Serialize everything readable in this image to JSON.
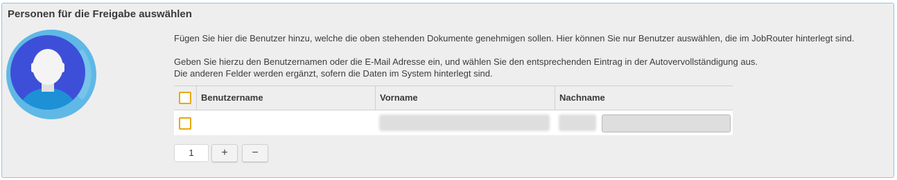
{
  "panel": {
    "title": "Personen für die Freigabe auswählen",
    "description_1": "Fügen Sie hier die Benutzer hinzu, welche die oben stehenden Dokumente genehmigen sollen. Hier können Sie nur Benutzer auswählen, die im JobRouter hinterlegt sind.",
    "description_2": "Geben Sie hierzu den Benutzernamen oder die E-Mail Adresse ein, und wählen Sie den entsprechenden Eintrag in der Autovervollständigung aus.",
    "description_3": "Die anderen Felder werden ergänzt, sofern die Daten im System hinterlegt sind."
  },
  "avatar": {
    "icon": "user-avatar-icon"
  },
  "table": {
    "columns": [
      "Benutzername",
      "Vorname",
      "Nachname"
    ],
    "rows": [
      {
        "checked": false
      }
    ]
  },
  "pager": {
    "row_count": "1",
    "add_label": "+",
    "remove_label": "−"
  },
  "colors": {
    "border": "#8fc3e6",
    "panel_bg": "#eeeeee",
    "checkbox": "#e8a800",
    "avatar_outer": "#5fb8e6",
    "avatar_inner": "#3d4fd8",
    "avatar_shirt": "#1e90d6"
  }
}
